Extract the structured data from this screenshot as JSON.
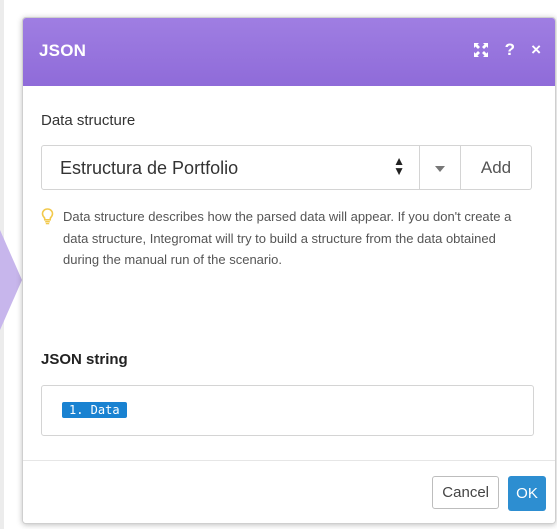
{
  "dialog": {
    "title": "JSON",
    "icons": [
      "expand-icon",
      "help-icon",
      "close-icon"
    ],
    "help_glyph": "?",
    "close_glyph": "×"
  },
  "data_structure": {
    "label": "Data structure",
    "selected": "Estructura de Portfolio",
    "add_label": "Add",
    "help_text": "Data structure describes how the parsed data will appear. If you don't create a data structure, Integromat will try to build a structure from the data obtained during the manual run of the scenario."
  },
  "json_string": {
    "label": "JSON string",
    "value_pill": "1. Data"
  },
  "footer": {
    "cancel_label": "Cancel",
    "ok_label": "OK"
  },
  "colors": {
    "header": "#9b7ae0",
    "pill": "#1982d1",
    "ok_button": "#2d8ed1",
    "bulb": "#f2c94c"
  }
}
